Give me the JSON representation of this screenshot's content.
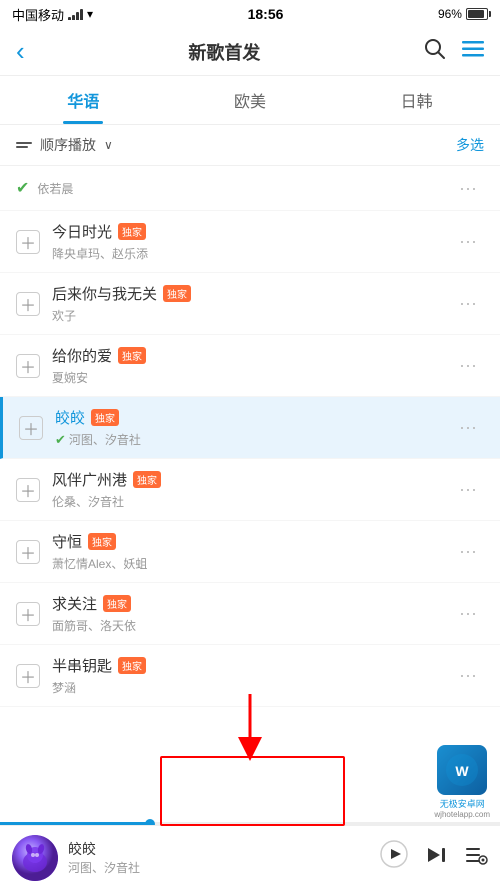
{
  "statusBar": {
    "carrier": "中国移动",
    "time": "18:56",
    "battery": "96%"
  },
  "header": {
    "title": "新歌首发",
    "backLabel": "‹",
    "searchLabel": "🔍",
    "menuLabel": "☰"
  },
  "tabs": [
    {
      "id": "chinese",
      "label": "华语",
      "active": true
    },
    {
      "id": "western",
      "label": "欧美",
      "active": false
    },
    {
      "id": "japanese",
      "label": "日韩",
      "active": false
    }
  ],
  "toolbar": {
    "shuffleLabel": "顺序播放",
    "shuffleArrow": "∨",
    "multiselectLabel": "多选"
  },
  "songs": [
    {
      "id": 0,
      "title": "依若晨",
      "artist": "依若晨",
      "exclusive": false,
      "verified": true,
      "isCurrentlyPlaying": false,
      "partialItem": true
    },
    {
      "id": 1,
      "title": "今日时光",
      "artist": "降央卓玛、赵乐添",
      "exclusive": true,
      "exclusiveLabel": "独家",
      "verified": false,
      "highlighted": false
    },
    {
      "id": 2,
      "title": "后来你与我无关",
      "artist": "欢子",
      "exclusive": true,
      "exclusiveLabel": "独家",
      "verified": false,
      "highlighted": false
    },
    {
      "id": 3,
      "title": "给你的爱",
      "artist": "夏婉安",
      "exclusive": true,
      "exclusiveLabel": "独家",
      "verified": false,
      "highlighted": false
    },
    {
      "id": 4,
      "title": "皎皎",
      "artist": "河图、汐音社",
      "exclusive": true,
      "exclusiveLabel": "独家",
      "verified": true,
      "highlighted": true
    },
    {
      "id": 5,
      "title": "风伴广州港",
      "artist": "伦桑、汐音社",
      "exclusive": true,
      "exclusiveLabel": "独家",
      "verified": false,
      "highlighted": false
    },
    {
      "id": 6,
      "title": "守恒",
      "artist": "萧忆情Alex、妖蛆",
      "exclusive": true,
      "exclusiveLabel": "独家",
      "verified": false,
      "highlighted": false
    },
    {
      "id": 7,
      "title": "求关注",
      "artist": "面筋哥、洛天依",
      "exclusive": true,
      "exclusiveLabel": "独家",
      "verified": false,
      "highlighted": false
    },
    {
      "id": 8,
      "title": "半串钥匙",
      "artist": "梦涵",
      "exclusive": true,
      "exclusiveLabel": "独家",
      "verified": false,
      "highlighted": false
    }
  ],
  "player": {
    "title": "皎皎",
    "artist": "河图、汐音社",
    "progress": 30
  },
  "watermark": {
    "text": "无极安卓网",
    "url": "wjhotelapp.com"
  }
}
